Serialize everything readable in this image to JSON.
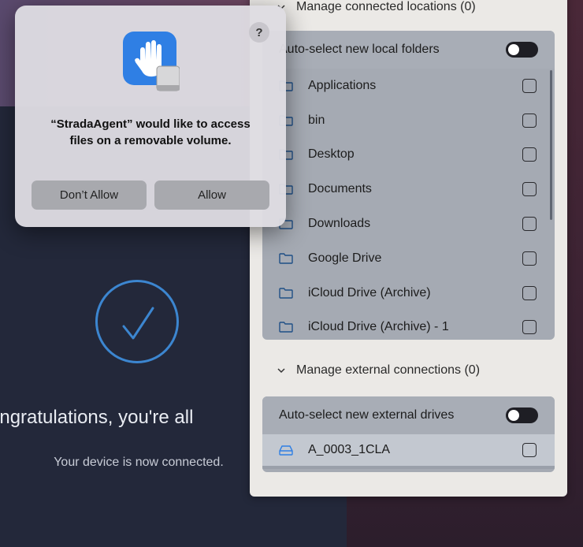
{
  "background": {
    "congrats_text": "ongratulations, you're all",
    "connected_text": "Your device is now connected."
  },
  "panel": {
    "locations_header": "Manage connected locations (0)",
    "local_toggle_label": "Auto-select new local folders",
    "folders": [
      {
        "label": "Applications"
      },
      {
        "label": "bin"
      },
      {
        "label": "Desktop"
      },
      {
        "label": "Documents"
      },
      {
        "label": "Downloads"
      },
      {
        "label": "Google Drive"
      },
      {
        "label": "iCloud Drive (Archive)"
      },
      {
        "label": "iCloud Drive (Archive) - 1"
      }
    ],
    "external_header": "Manage external connections (0)",
    "external_toggle_label": "Auto-select new external drives",
    "drives": [
      {
        "label": "A_0003_1CLA"
      }
    ]
  },
  "dialog": {
    "help": "?",
    "message": "“StradaAgent” would like to access files on a removable volume.",
    "deny_label": "Don’t Allow",
    "allow_label": "Allow"
  },
  "colors": {
    "accent_blue": "#3c86d0",
    "toggle_off": "#1e1e24"
  },
  "icons": [
    "checkmark-circle-icon",
    "chevron-down-icon",
    "folder-icon",
    "drive-icon",
    "hand-stop-icon"
  ]
}
